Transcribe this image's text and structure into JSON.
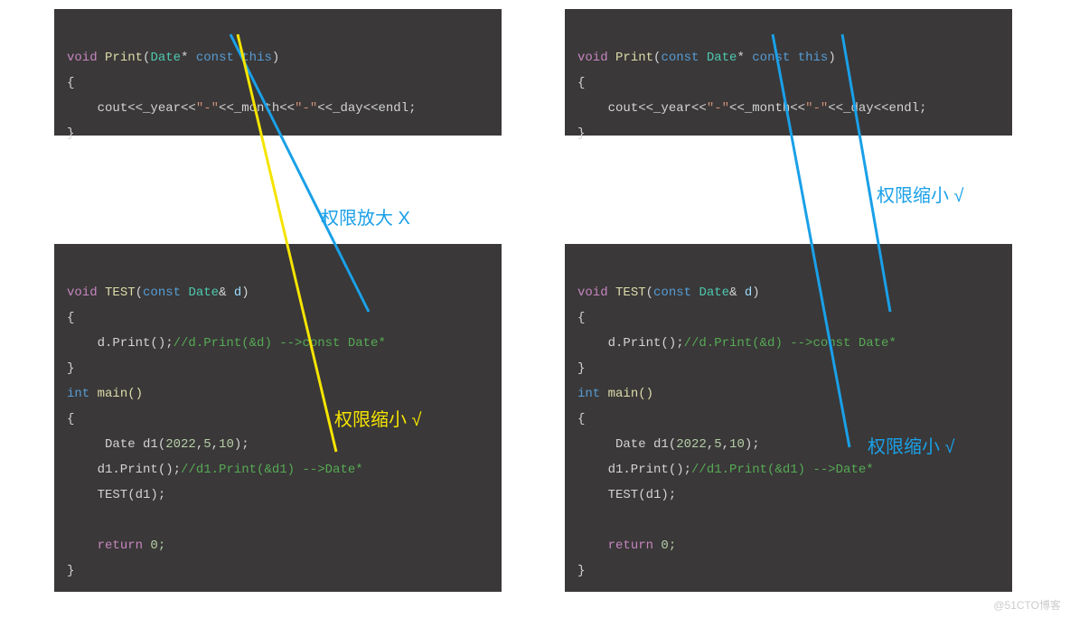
{
  "panels": {
    "tl": {
      "void": "void",
      "fn": "Print",
      "sig_pre": "(",
      "type": "Date",
      "star": "* ",
      "const": "const",
      "this": " this",
      "sig_post": ")",
      "brace_open": "{",
      "indent": "    ",
      "cout": "cout<<_year<<",
      "s1": "\"-\"",
      "mid": "<<_month<<",
      "s2": "\"-\"",
      "tail": "<<_day<<endl;",
      "brace_close": "}"
    },
    "tr": {
      "void": "void",
      "fn": "Print",
      "sig_pre": "(",
      "const1": "const",
      "type": " Date",
      "star": "* ",
      "const2": "const",
      "this": " this",
      "sig_post": ")",
      "brace_open": "{",
      "indent": "    ",
      "cout": "cout<<_year<<",
      "s1": "\"-\"",
      "mid": "<<_month<<",
      "s2": "\"-\"",
      "tail": "<<_day<<endl;",
      "brace_close": "}"
    },
    "bl": {
      "void": "void",
      "fn_test": "TEST",
      "sig1_pre": "(",
      "const": "const",
      "type": " Date",
      "amp": "& ",
      "param": "d",
      "sig1_post": ")",
      "brace_open": "{",
      "call_line_pre": "    d.Print();",
      "call_cmt1": "//d.Print(&d) -->const Date*",
      "brace_close": "}",
      "int": "int",
      "main": " main()",
      "d1_decl_pre": "     Date d1(",
      "n1": "2022",
      "c": ",",
      "n2": "5",
      "n3": "10",
      "d1_decl_post": ");",
      "d1_print": "    d1.Print();",
      "d1_cmt": "//d1.Print(&d1) -->Date*",
      "test_call": "    TEST(d1);",
      "return": "return",
      "zero": " 0;",
      "blank": ""
    },
    "br": {
      "void": "void",
      "fn_test": "TEST",
      "sig1_pre": "(",
      "const": "const",
      "type": " Date",
      "amp": "& ",
      "param": "d",
      "sig1_post": ")",
      "brace_open": "{",
      "call_line_pre": "    d.Print();",
      "call_cmt1": "//d.Print(&d) -->const Date*",
      "brace_close": "}",
      "int": "int",
      "main": " main()",
      "d1_decl_pre": "     Date d1(",
      "n1": "2022",
      "c": ",",
      "n2": "5",
      "n3": "10",
      "d1_decl_post": ");",
      "d1_print": "    d1.Print();",
      "d1_cmt": "//d1.Print(&d1) -->Date*",
      "test_call": "    TEST(d1);",
      "return": "return",
      "zero": " 0;",
      "blank": ""
    }
  },
  "annotations": {
    "enlarge": "权限放大 X",
    "shrink_yellow": "权限缩小 √",
    "shrink_tr": "权限缩小 √",
    "shrink_br": "权限缩小 √"
  },
  "watermark": "@51CTO博客"
}
